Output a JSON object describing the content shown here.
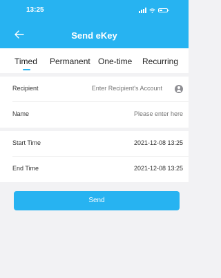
{
  "status": {
    "time": "13:25"
  },
  "header": {
    "title": "Send eKey"
  },
  "tabs": [
    {
      "label": "Timed",
      "active": true
    },
    {
      "label": "Permanent",
      "active": false
    },
    {
      "label": "One-time",
      "active": false
    },
    {
      "label": "Recurring",
      "active": false
    }
  ],
  "form": {
    "recipient": {
      "label": "Recipient",
      "placeholder": "Enter Recipient's Account",
      "value": ""
    },
    "name": {
      "label": "Name",
      "placeholder": "Please enter here",
      "value": ""
    },
    "start_time": {
      "label": "Start Time",
      "value": "2021-12-08 13:25"
    },
    "end_time": {
      "label": "End Time",
      "value": "2021-12-08 13:25"
    }
  },
  "actions": {
    "send_label": "Send"
  },
  "colors": {
    "accent": "#27b3f1",
    "background": "#f2f2f4"
  },
  "icons": {
    "back": "arrow-left-icon",
    "contact": "contact-icon"
  }
}
